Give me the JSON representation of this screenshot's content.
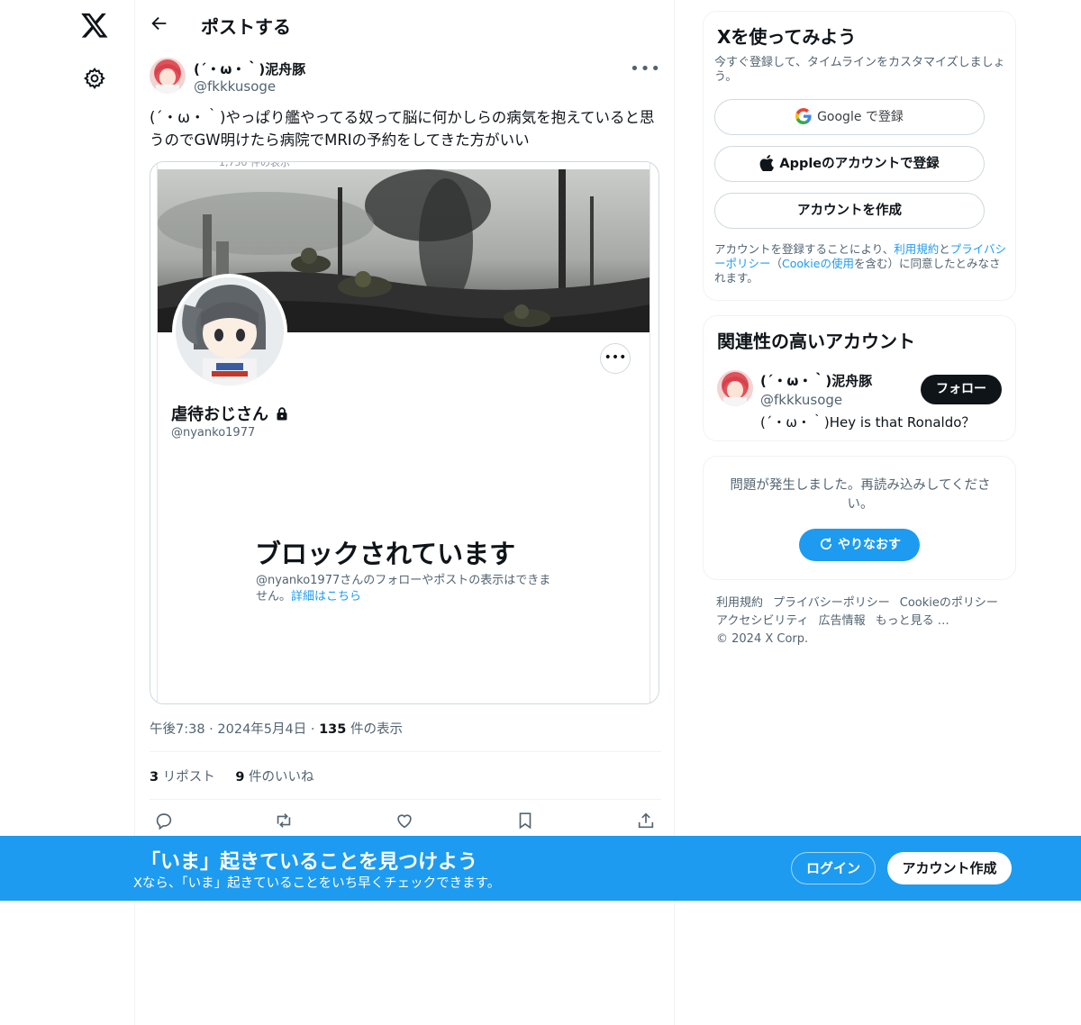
{
  "nav": {
    "logo_icon": "x-logo-icon",
    "settings_icon": "gear-icon"
  },
  "header": {
    "back_icon": "arrow-left-icon",
    "title": "ポストする"
  },
  "post": {
    "author_name": "(´・ω・｀)泥舟豚",
    "author_handle": "@fkkkusoge",
    "more_label": "•••",
    "text": "(´・ω・｀)やっぱり艦やってる奴って脳に何かしらの病気を抱えていると思うのでGW明けたら病院でMRIの予約をしてきた方がいい",
    "screenshot": {
      "cut_text": "1,750 件の表示",
      "profile_name": "虐待おじさん",
      "profile_handle": "@nyanko1977",
      "more_label": "•••",
      "blocked_title": "ブロックされています",
      "blocked_body": "@nyanko1977さんのフォローやポストの表示はできません。",
      "blocked_link": "詳細はこちら"
    },
    "time": "午後7:38",
    "date": "2024年5月4日",
    "views_count": "135",
    "views_label": " 件の表示",
    "separator": " · ",
    "reposts_count": "3",
    "reposts_label": " リポスト",
    "likes_count": "9",
    "likes_label": " 件のいいね"
  },
  "signup_card": {
    "title": "Xを使ってみよう",
    "subtitle": "今すぐ登録して、タイムラインをカスタマイズしましょう。",
    "google_label": "Google で登録",
    "apple_label": "Appleのアカウントで登録",
    "create_label": "アカウントを作成",
    "legal_prefix": "アカウントを登録することにより、",
    "legal_terms": "利用規約",
    "legal_and": "と",
    "legal_privacy": "プライバシーポリシー",
    "legal_mid": "（",
    "legal_cookie": "Cookieの使用",
    "legal_suffix": "を含む）に同意したとみなされます。"
  },
  "relevant": {
    "title": "関連性の高いアカウント",
    "name": "(´・ω・｀)泥舟豚",
    "handle": "@fkkkusoge",
    "bio": "(´・ω・｀)Hey is that Ronaldo？",
    "follow_label": "フォロー"
  },
  "error_card": {
    "message": "問題が発生しました。再読み込みしてください。",
    "retry_label": "やりなおす"
  },
  "footer": {
    "links": [
      "利用規約",
      "プライバシーポリシー",
      "Cookieのポリシー",
      "アクセシビリティ",
      "広告情報",
      "もっと見る …"
    ],
    "copyright": "© 2024 X Corp."
  },
  "bottom_banner": {
    "title": "「いま」起きていることを見つけよう",
    "subtitle": "Xなら、「いま」起きていることをいち早くチェックできます。",
    "login_label": "ログイン",
    "signup_label": "アカウント作成"
  },
  "colors": {
    "accent": "#1d9bf0",
    "text": "#0f1419",
    "muted": "#536471",
    "border": "#eff3f4"
  }
}
